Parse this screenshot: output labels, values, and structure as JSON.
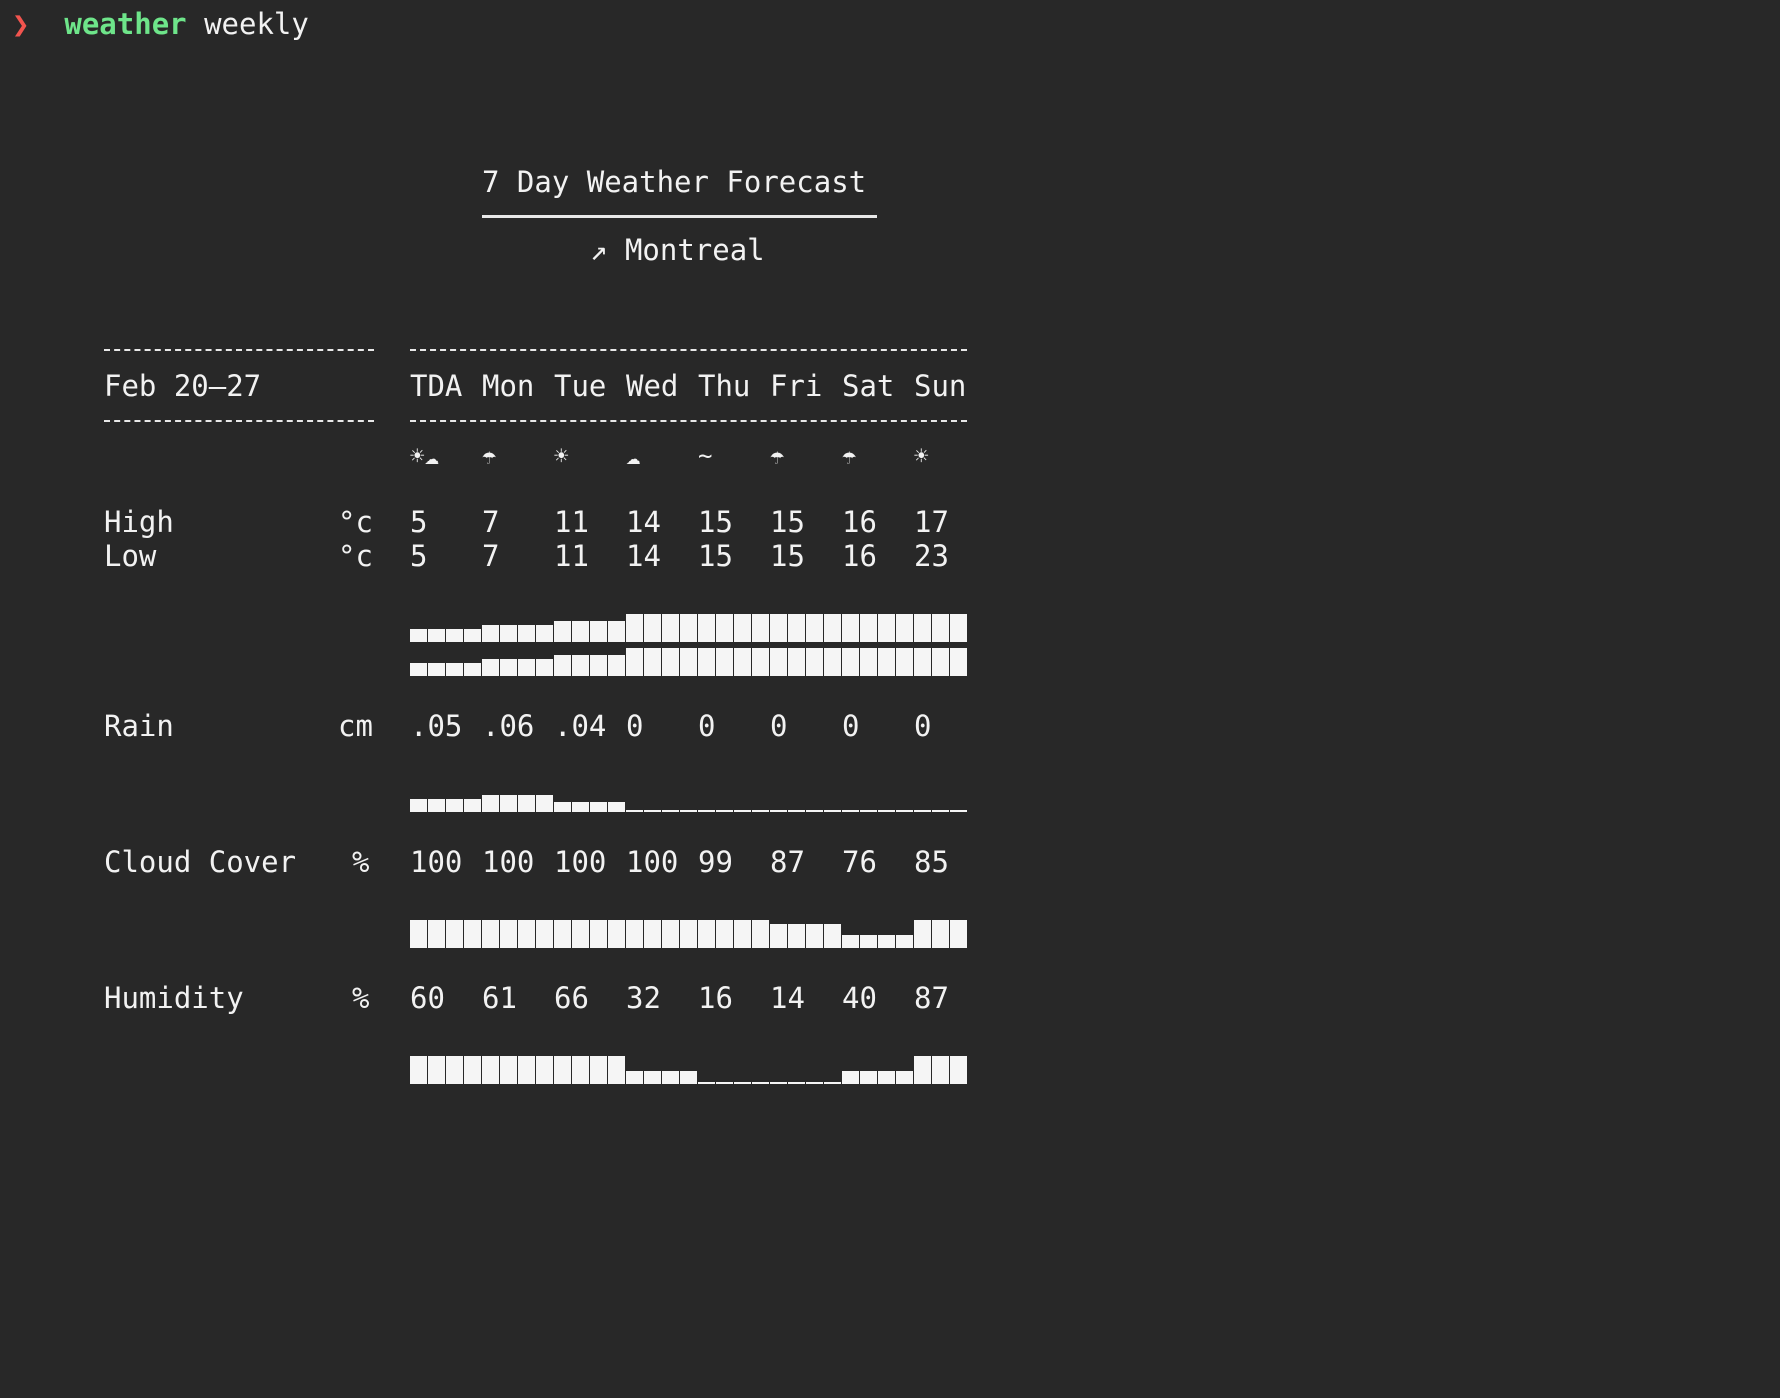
{
  "terminal": {
    "prompt_symbol": "❯",
    "command": "weather",
    "argument": "weekly"
  },
  "forecast": {
    "title": "7 Day Weather Forecast",
    "location_icon": "↗",
    "location": "Montreal",
    "date_range": "Feb 20–27",
    "days": [
      "TDA",
      "Mon",
      "Tue",
      "Wed",
      "Thu",
      "Fri",
      "Sat",
      "Sun"
    ],
    "icons": [
      "☀☁",
      "☂",
      "☀",
      "☁",
      "~",
      "☂",
      "☂",
      "☀"
    ],
    "icon_names": [
      "sun-cloud-icon",
      "umbrella-icon",
      "sun-icon",
      "cloud-icon",
      "wind-icon",
      "umbrella-icon",
      "umbrella-icon",
      "sun-icon"
    ],
    "rows": {
      "high": {
        "label": "High",
        "unit": "°c",
        "values": [
          "5",
          "7",
          "11",
          "14",
          "15",
          "15",
          "16",
          "17"
        ]
      },
      "low": {
        "label": "Low",
        "unit": "°c",
        "values": [
          "5",
          "7",
          "11",
          "14",
          "15",
          "15",
          "16",
          "23"
        ]
      },
      "rain": {
        "label": "Rain",
        "unit": "cm",
        "values": [
          ".05",
          ".06",
          ".04",
          "0",
          "0",
          "0",
          "0",
          "0"
        ]
      },
      "cloud": {
        "label": "Cloud Cover",
        "unit": "%",
        "values": [
          "100",
          "100",
          "100",
          "100",
          "99",
          "87",
          "76",
          "85"
        ]
      },
      "humidity": {
        "label": "Humidity",
        "unit": "%",
        "values": [
          "60",
          "61",
          "66",
          "32",
          "16",
          "14",
          "40",
          "87"
        ]
      }
    },
    "bars": {
      "high_levels": [
        0.45,
        0.6,
        0.75,
        1,
        1,
        1,
        1,
        1
      ],
      "low_levels": [
        0.45,
        0.6,
        0.75,
        1,
        1,
        1,
        1,
        1
      ],
      "rain_levels": [
        0.45,
        0.6,
        0.35,
        0,
        0,
        0,
        0,
        0
      ],
      "cloud_levels": [
        1,
        1,
        1,
        1,
        1,
        0.85,
        0.45,
        1
      ],
      "humidity_levels": [
        1,
        1,
        1,
        0.45,
        0,
        0,
        0.45,
        1
      ]
    }
  }
}
